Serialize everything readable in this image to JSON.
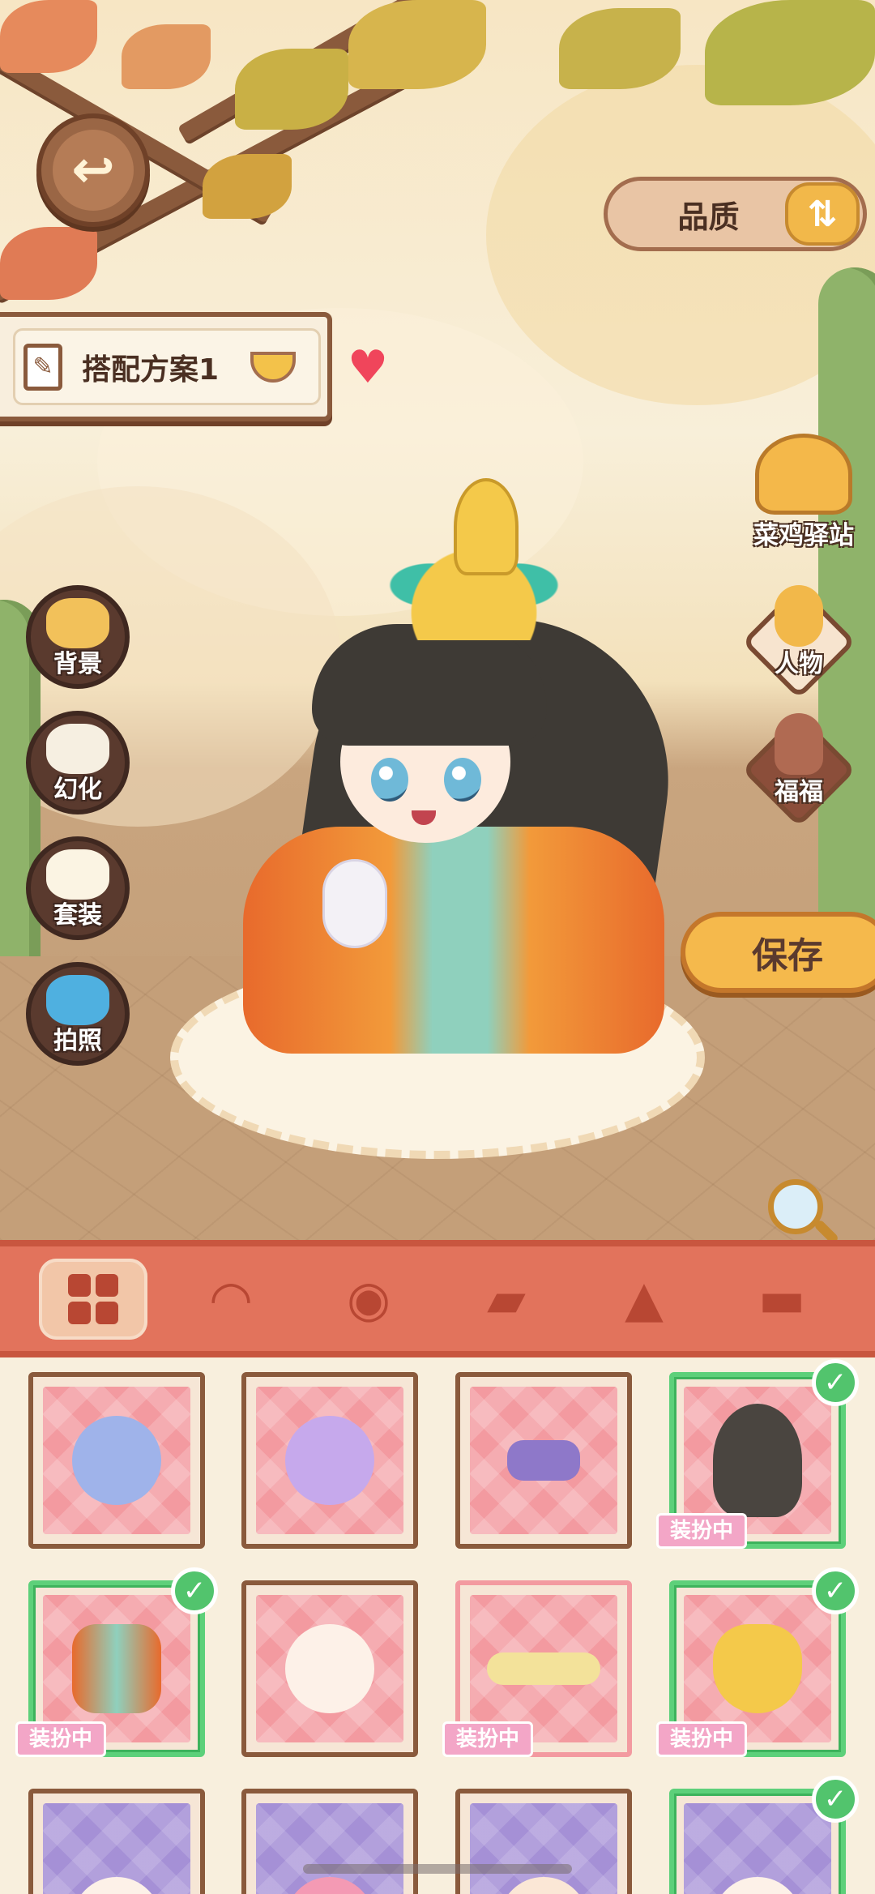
{
  "top": {
    "back_icon": "back-arrow-icon",
    "quality_label": "品质",
    "quality_toggle_glyph": "⇅"
  },
  "plan": {
    "name": "搭配方案1",
    "favorite": "♥"
  },
  "left_menu": [
    {
      "id": "background",
      "label": "背景",
      "icon": "paint-brush-icon"
    },
    {
      "id": "transform",
      "label": "幻化",
      "icon": "palette-icon"
    },
    {
      "id": "outfit",
      "label": "套装",
      "icon": "hanger-icon"
    },
    {
      "id": "photo",
      "label": "拍照",
      "icon": "camera-icon"
    }
  ],
  "right_menu": {
    "shop_label": "菜鸡驿站",
    "character_label": "人物",
    "pet_label": "福福"
  },
  "save_label": "保存",
  "categories": [
    {
      "id": "all",
      "icon": "grid-icon",
      "active": true
    },
    {
      "id": "hair",
      "icon": "hair-icon",
      "active": false
    },
    {
      "id": "eyes",
      "icon": "eye-icon",
      "active": false
    },
    {
      "id": "top",
      "icon": "shirt-icon",
      "active": false
    },
    {
      "id": "dress",
      "icon": "dress-icon",
      "active": false
    },
    {
      "id": "bottom",
      "icon": "shorts-icon",
      "active": false
    }
  ],
  "equipped_tag": "装扮中",
  "items": [
    {
      "row": 1,
      "col": 1,
      "name": "blue-dragon-hair",
      "equipped": false,
      "bg": "pink"
    },
    {
      "row": 1,
      "col": 2,
      "name": "purple-skirt",
      "equipped": false,
      "bg": "pink"
    },
    {
      "row": 1,
      "col": 3,
      "name": "purple-shoes",
      "equipped": false,
      "bg": "pink"
    },
    {
      "row": 1,
      "col": 4,
      "name": "long-black-hair",
      "equipped": true,
      "bg": "pink"
    },
    {
      "row": 2,
      "col": 1,
      "name": "orange-hanfu",
      "equipped": true,
      "bg": "pink"
    },
    {
      "row": 2,
      "col": 2,
      "name": "face-base",
      "equipped": false,
      "bg": "pink"
    },
    {
      "row": 2,
      "col": 3,
      "name": "ribbon-sash",
      "equipped": true,
      "bg": "pink"
    },
    {
      "row": 2,
      "col": 4,
      "name": "phoenix-crown",
      "equipped": true,
      "bg": "pink"
    },
    {
      "row": 3,
      "col": 1,
      "name": "face-purple-1",
      "equipped": false,
      "bg": "purple"
    },
    {
      "row": 3,
      "col": 2,
      "name": "pink-hair-face",
      "equipped": false,
      "bg": "purple"
    },
    {
      "row": 3,
      "col": 3,
      "name": "cat-ear-face",
      "equipped": false,
      "bg": "purple"
    },
    {
      "row": 3,
      "col": 4,
      "name": "face-purple-2",
      "equipped": true,
      "bg": "purple"
    }
  ],
  "colors": {
    "category_bar": "#e2735c",
    "equipped_border": "#5dd07a",
    "save_button": "#f5b94c",
    "tag_pink": "#f3a6c7"
  }
}
